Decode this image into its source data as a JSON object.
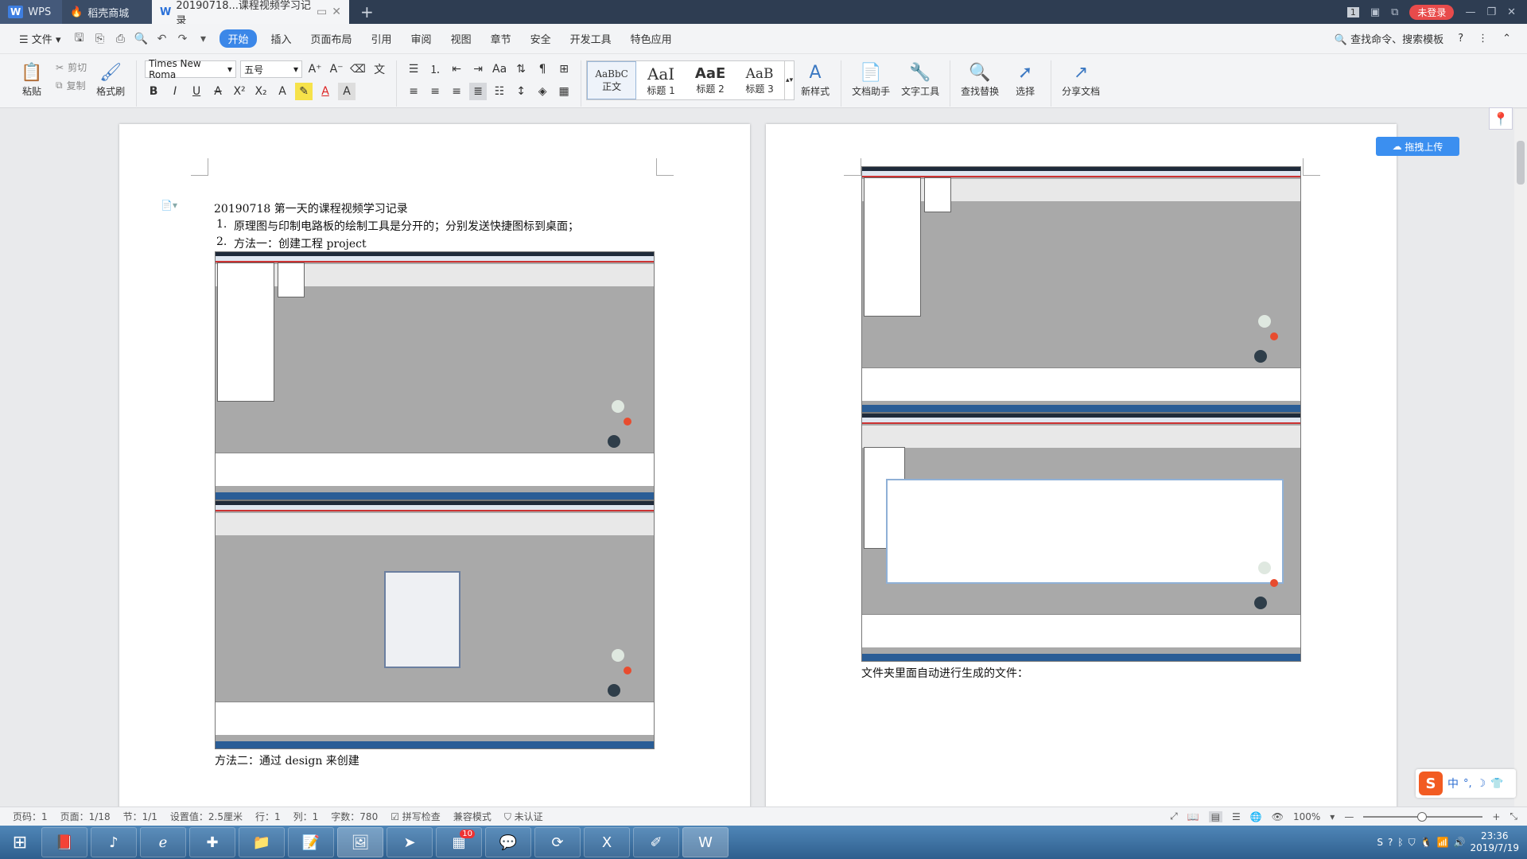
{
  "tabs": {
    "wps": "WPS",
    "store": "稻壳商城",
    "doc": "20190718...课程视频学习记录",
    "login": "未登录",
    "page_indicator": "1"
  },
  "menu": {
    "file": "文件",
    "items": [
      "开始",
      "插入",
      "页面布局",
      "引用",
      "审阅",
      "视图",
      "章节",
      "安全",
      "开发工具",
      "特色应用"
    ],
    "search": "查找命令、搜索模板"
  },
  "ribbon": {
    "paste": "粘贴",
    "cut": "剪切",
    "copy": "复制",
    "format_painter": "格式刷",
    "font_name": "Times New Roma",
    "font_size": "五号",
    "styles": [
      {
        "preview": "AaBbC",
        "label": "正文"
      },
      {
        "preview": "AaI",
        "label": "标题 1"
      },
      {
        "preview": "AaE",
        "label": "标题 2"
      },
      {
        "preview": "AaB",
        "label": "标题 3"
      }
    ],
    "new_style": "新样式",
    "doc_assistant": "文档助手",
    "text_tools": "文字工具",
    "find_replace": "查找替换",
    "select": "选择",
    "share": "分享文档"
  },
  "document": {
    "page1": {
      "title": "20190718 第一天的课程视频学习记录",
      "item1_num": "1.",
      "item1": "原理图与印制电路板的绘制工具是分开的；分别发送快捷图标到桌面；",
      "item2_num": "2.",
      "item2": "方法一：创建工程 project",
      "method2": "方法二：通过 design 来创建"
    },
    "page2": {
      "caption": "文件夹里面自动进行生成的文件："
    },
    "upload_button": "拖拽上传"
  },
  "statusbar": {
    "page_code": "页码：1",
    "page": "页面：1/18",
    "section": "节：1/1",
    "setting": "设置值：2.5厘米",
    "row": "行：1",
    "col": "列：1",
    "words": "字数：780",
    "spell": "拼写检查",
    "compat": "兼容模式",
    "cert": "未认证",
    "zoom": "100%"
  },
  "ime": {
    "logo": "S",
    "lang": "中"
  },
  "taskbar": {
    "badge": "10",
    "time": "23:36",
    "date": "2019/7/19"
  }
}
